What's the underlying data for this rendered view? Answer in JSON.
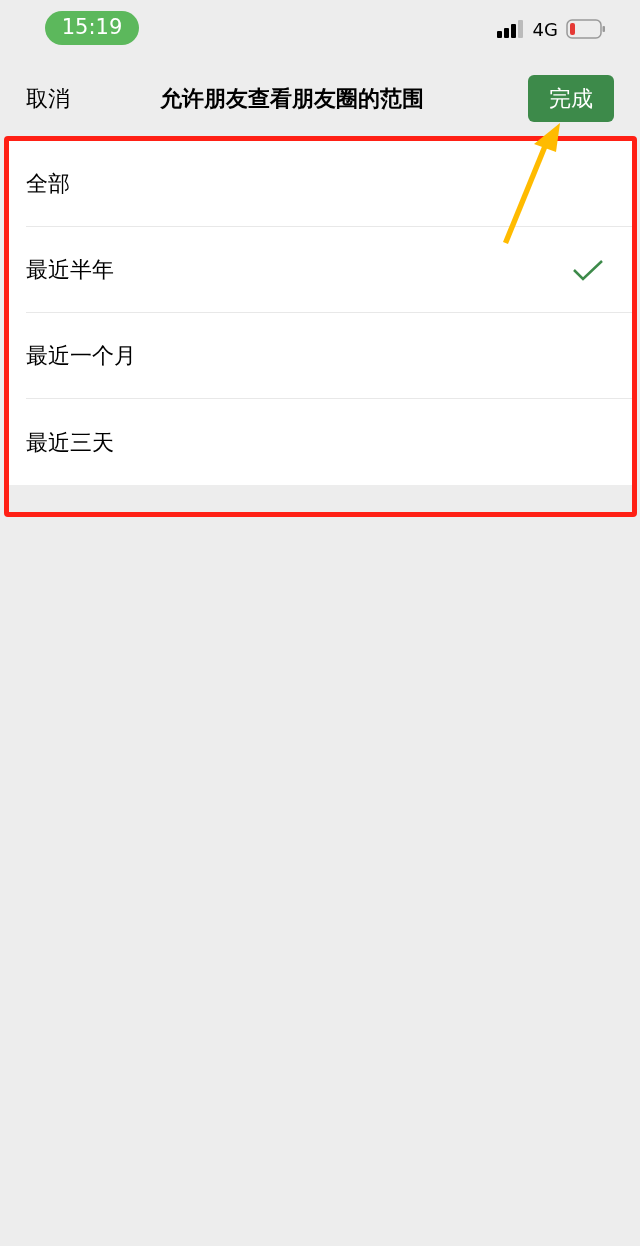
{
  "status_bar": {
    "time": "15:19",
    "network": "4G"
  },
  "header": {
    "cancel": "取消",
    "title": "允许朋友查看朋友圈的范围",
    "done": "完成"
  },
  "options": [
    {
      "label": "全部",
      "selected": false
    },
    {
      "label": "最近半年",
      "selected": true
    },
    {
      "label": "最近一个月",
      "selected": false
    },
    {
      "label": "最近三天",
      "selected": false
    }
  ]
}
